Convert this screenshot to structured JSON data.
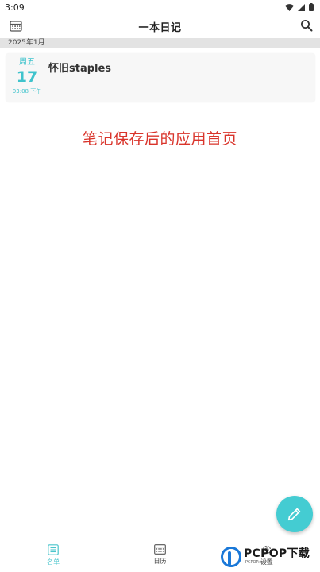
{
  "status_bar": {
    "time": "3:09",
    "icons": [
      "wifi-icon",
      "signal-icon",
      "battery-icon"
    ]
  },
  "app_bar": {
    "title": "一本日记",
    "left_icon": "calendar-grid-icon",
    "right_icon": "search-icon"
  },
  "month_header": "2025年1月",
  "entries": [
    {
      "weekday": "周五",
      "day": "17",
      "time": "03:08 下午",
      "title": "怀旧staples"
    }
  ],
  "caption": "笔记保存后的应用首页",
  "fab": {
    "icon": "pencil-icon"
  },
  "bottom_nav": [
    {
      "label": "名单",
      "icon": "list-icon",
      "active": true
    },
    {
      "label": "日历",
      "icon": "calendar-icon",
      "active": false
    },
    {
      "label": "设置",
      "icon": "gear-icon",
      "active": false
    }
  ],
  "watermark": {
    "text": "PCPOP下载",
    "sub": "PCPOP.com"
  },
  "colors": {
    "accent": "#44ccd2",
    "caption": "#d9342b",
    "month_header_bg": "#e3e3e3",
    "card_bg": "#f7f7f7"
  }
}
